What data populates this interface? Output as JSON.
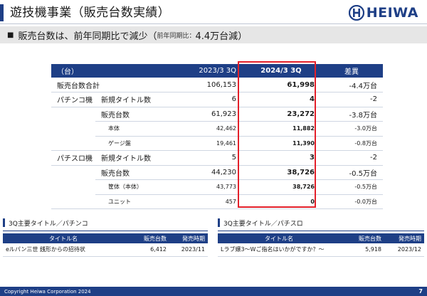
{
  "header": {
    "title": "遊技機事業（販売台数実績）",
    "logo_text": "HEIWA",
    "logo_icon": "heiwa-emblem-icon",
    "brand_color": "#1e3f86"
  },
  "subhead": {
    "bullet": "■",
    "main": "販売台数は、前年同期比で減少",
    "open_paren": "（",
    "note": "前年同期比：",
    "amount": "4.4万台減",
    "close_paren": "）"
  },
  "main_table": {
    "headers": {
      "unit": "（台）",
      "prev": "2023/3 3Q",
      "cur": "2024/3 3Q",
      "diff": "差異"
    },
    "rows": [
      {
        "cat": "販売台数合計",
        "sub": "",
        "prev": "106,153",
        "cur": "61,998",
        "diff": "-4.4万台"
      },
      {
        "cat": "パチンコ機",
        "sub": "新規タイトル数",
        "prev": "6",
        "cur": "4",
        "diff": "-2"
      },
      {
        "cat": "",
        "sub": "販売台数",
        "prev": "61,923",
        "cur": "23,272",
        "diff": "-3.8万台"
      },
      {
        "cat": "",
        "sub": "本体",
        "prev": "42,462",
        "cur": "11,882",
        "diff": "-3.0万台"
      },
      {
        "cat": "",
        "sub": "ゲージ盤",
        "prev": "19,461",
        "cur": "11,390",
        "diff": "-0.8万台"
      },
      {
        "cat": "パチスロ機",
        "sub": "新規タイトル数",
        "prev": "5",
        "cur": "3",
        "diff": "-2"
      },
      {
        "cat": "",
        "sub": "販売台数",
        "prev": "44,230",
        "cur": "38,726",
        "diff": "-0.5万台"
      },
      {
        "cat": "",
        "sub": "筐体（本体）",
        "prev": "43,773",
        "cur": "38,726",
        "diff": "-0.5万台"
      },
      {
        "cat": "",
        "sub": "ユニット",
        "prev": "457",
        "cur": "0",
        "diff": "-0.0万台"
      }
    ],
    "highlight_color": "#e3202a"
  },
  "pachinko_table": {
    "title": "3Q主要タイトル／パチンコ",
    "headers": {
      "name": "タイトル名",
      "units": "販売台数",
      "period": "発売時期"
    },
    "row": {
      "name": "eルパン三世 銭形からの招待状",
      "units": "6,412",
      "period": "2023/11"
    }
  },
  "pachislot_table": {
    "title": "3Q主要タイトル／パチスロ",
    "headers": {
      "name": "タイトル名",
      "units": "販売台数",
      "period": "発売時期"
    },
    "row": {
      "name": "Lラブ嬢3～Wご指名はいかがですか？～",
      "units": "5,918",
      "period": "2023/12"
    }
  },
  "footer": {
    "copyright": "Copyright  Heiwa Corporation  2024",
    "page": "7"
  }
}
